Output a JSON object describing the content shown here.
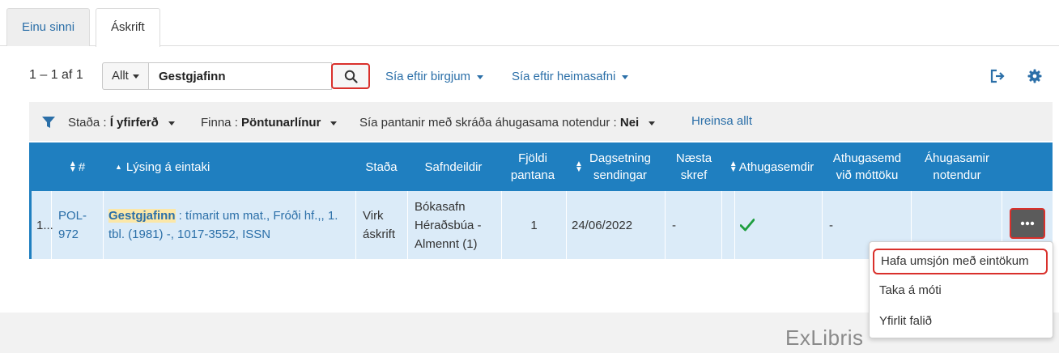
{
  "tabs": [
    {
      "label": "Einu sinni",
      "active": false
    },
    {
      "label": "Áskrift",
      "active": true
    }
  ],
  "toolbar": {
    "count": "1 – 1 af 1",
    "scope": "Allt",
    "search_value": "Gestgjafinn",
    "filter_vendor": "Sía eftir birgjum",
    "filter_library": "Sía eftir heimasafni"
  },
  "filters": {
    "status_label": "Staða :",
    "status_value": "Í yfirferð",
    "find_label": "Finna :",
    "find_value": "Pöntunarlínur",
    "interested_label": "Sía pantanir með skráða áhugasama notendur :",
    "interested_value": "Nei",
    "clear_all": "Hreinsa allt"
  },
  "table": {
    "headers": {
      "num": "#",
      "description": "Lýsing á eintaki",
      "status": "Staða",
      "library": "Safndeildir",
      "order_count": "Fjöldi pantana",
      "ship_date": "Dagsetning sendingar",
      "next_step": "Næsta skref",
      "notes": "Athugasemdir",
      "receiving_note": "Athugasemd við móttöku",
      "interested_users": "Áhugasamir notendur"
    },
    "row": {
      "index": "1...",
      "pol": "POL-972",
      "title_highlight": "Gestgjafinn",
      "title_rest": " : tímarit um mat., Fróði hf.,, 1. tbl. (1981) -, 1017-3552, ISSN",
      "status": "Virk áskrift",
      "library": "Bókasafn Héraðsbúa - Almennt (1)",
      "order_count": "1",
      "ship_date": "24/06/2022",
      "next_step": "-",
      "receiving_note": "-"
    }
  },
  "row_menu": {
    "items": [
      "Hafa umsjón með eintökum",
      "Taka á móti",
      "Yfirlit falið"
    ]
  },
  "footer": {
    "logo": "ExLibris"
  },
  "colors": {
    "accent": "#1f7fc0",
    "link": "#2b6fa8",
    "highlight_border": "#d9302b",
    "check": "#1e9e3e"
  }
}
